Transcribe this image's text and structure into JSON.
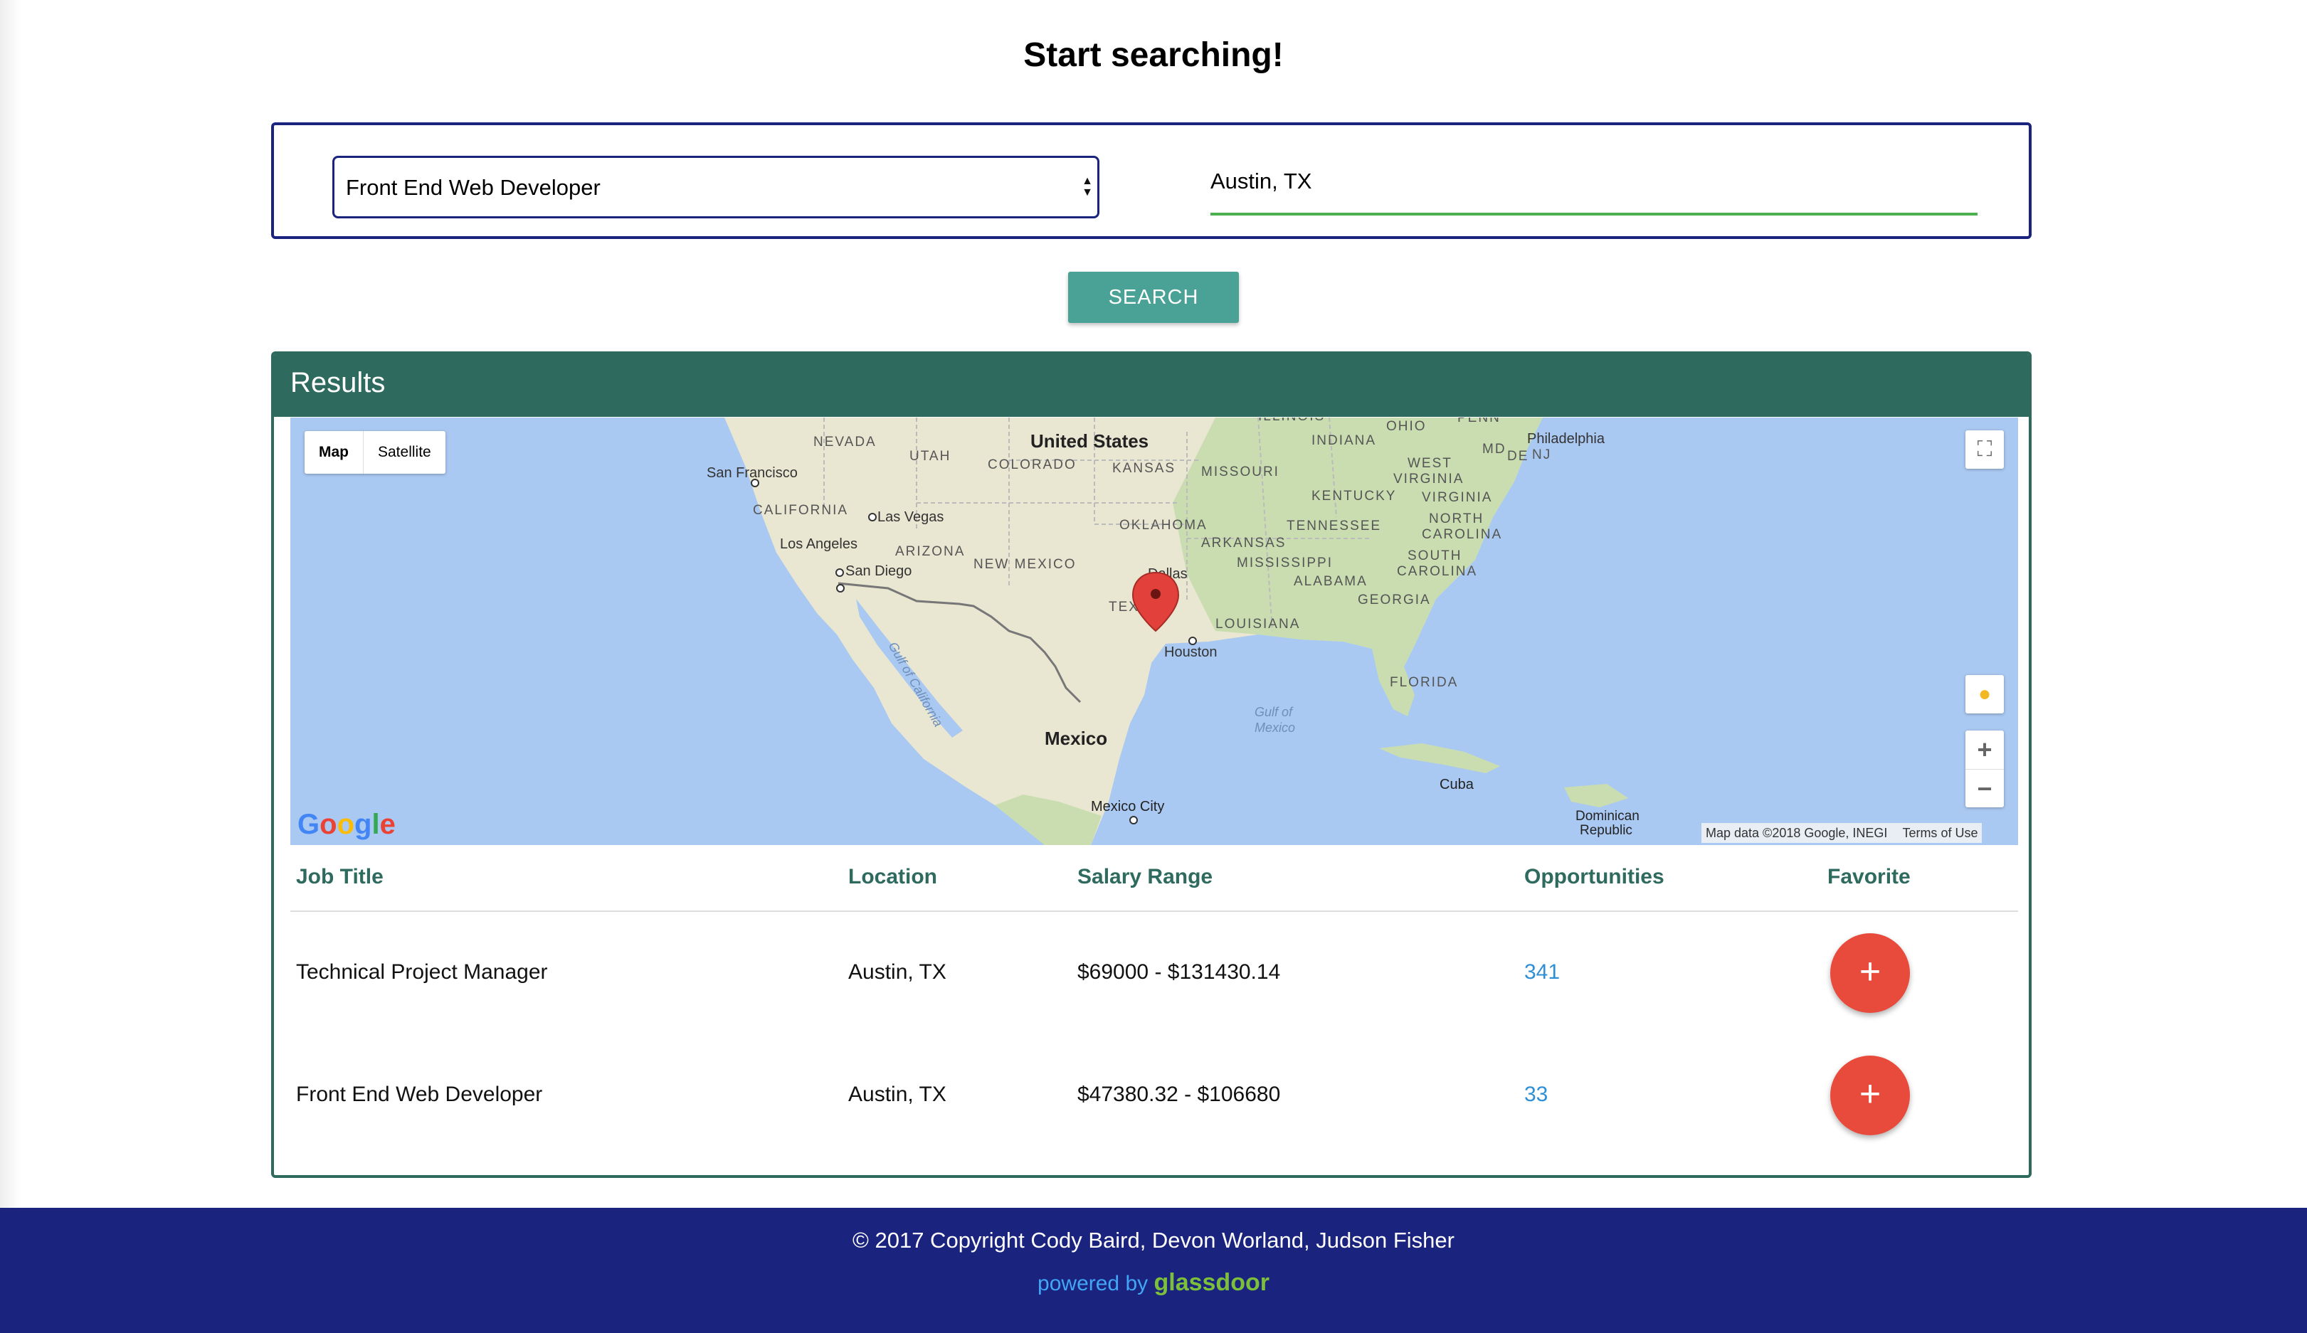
{
  "page": {
    "title": "Start searching!"
  },
  "search": {
    "job_title": "Front End Web Developer",
    "location": "Austin, TX",
    "button_label": "SEARCH"
  },
  "results": {
    "heading": "Results",
    "map": {
      "type_map": "Map",
      "type_satellite": "Satellite",
      "attribution": "Map data ©2018 Google, INEGI",
      "terms": "Terms of Use",
      "logo": "Google",
      "zoom_in": "+",
      "zoom_out": "−",
      "labels": {
        "us": "United States",
        "mexico": "Mexico",
        "nevada": "NEVADA",
        "utah": "UTAH",
        "colorado": "COLORADO",
        "kansas": "KANSAS",
        "missouri": "MISSOURI",
        "illinois": "ILLINOIS",
        "indiana": "INDIANA",
        "ohio": "OHIO",
        "penn": "PENN",
        "md": "MD",
        "de": "DE",
        "nj": "NJ",
        "philadelphia": "Philadelphia",
        "west_virginia_1": "WEST",
        "west_virginia_2": "VIRGINIA",
        "virginia": "VIRGINIA",
        "kentucky": "KENTUCKY",
        "tennessee": "TENNESSEE",
        "north_carolina_1": "NORTH",
        "north_carolina_2": "CAROLINA",
        "south_carolina_1": "SOUTH",
        "south_carolina_2": "CAROLINA",
        "georgia": "GEORGIA",
        "alabama": "ALABAMA",
        "mississippi": "MISSISSIPPI",
        "arkansas": "ARKANSAS",
        "louisiana": "LOUISIANA",
        "oklahoma": "OKLAHOMA",
        "texas": "TEXA",
        "new_mexico": "NEW MEXICO",
        "arizona": "ARIZONA",
        "california": "CALIFORNIA",
        "san_francisco": "San Francisco",
        "las_vegas": "Las Vegas",
        "los_angeles": "Los Angeles",
        "san_diego": "San Diego",
        "dallas": "Dallas",
        "houston": "Houston",
        "florida": "FLORIDA",
        "gulf_mexico_1": "Gulf of",
        "gulf_mexico_2": "Mexico",
        "gulf_california": "Gulf of California",
        "cuba": "Cuba",
        "mexico_city": "Mexico City",
        "dominican_1": "Dominican",
        "dominican_2": "Republic"
      }
    },
    "columns": {
      "job_title": "Job Title",
      "location": "Location",
      "salary_range": "Salary Range",
      "opportunities": "Opportunities",
      "favorite": "Favorite"
    },
    "rows": [
      {
        "job_title": "Technical Project Manager",
        "location": "Austin, TX",
        "salary_range": "$69000 - $131430.14",
        "opportunities": "341",
        "favorite_label": "+"
      },
      {
        "job_title": "Front End Web Developer",
        "location": "Austin, TX",
        "salary_range": "$47380.32 - $106680",
        "opportunities": "33",
        "favorite_label": "+"
      }
    ]
  },
  "footer": {
    "copyright": "© 2017 Copyright Cody Baird, Devon Worland, Judson Fisher",
    "powered_by": "powered by",
    "brand": "glassdoor"
  },
  "colors": {
    "navy": "#1a237e",
    "header_green": "#2e6b5e",
    "button_teal": "#4aa195",
    "favorite_red": "#e84b3c",
    "link_blue": "#2f8fd6"
  }
}
